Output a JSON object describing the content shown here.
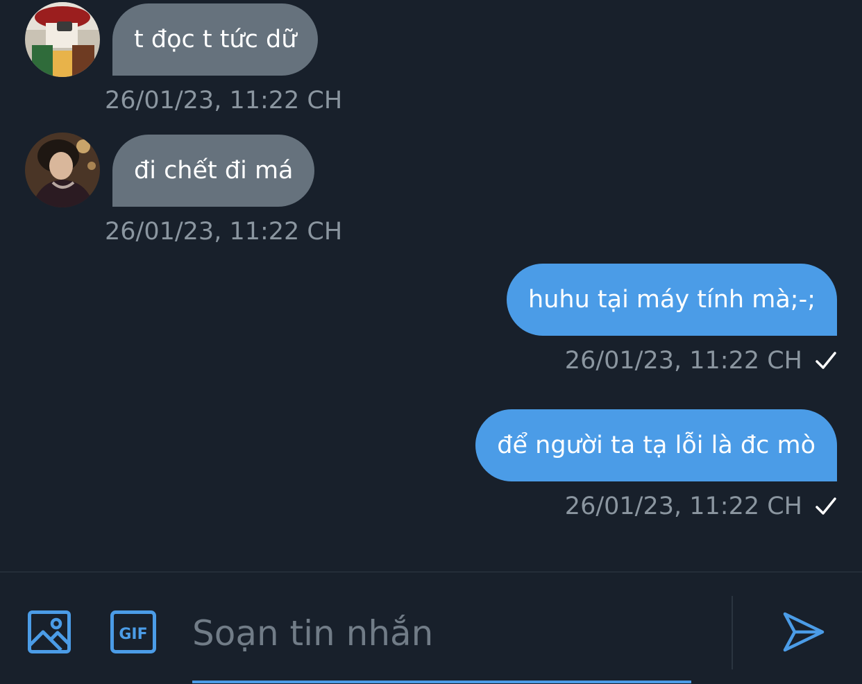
{
  "messages": [
    {
      "direction": "incoming",
      "text": "t đọc t tức dữ",
      "time": "26/01/23, 11:22 CH",
      "avatar": "avatar-photo-1"
    },
    {
      "direction": "incoming",
      "text": "đi chết đi má",
      "time": "26/01/23, 11:22 CH",
      "avatar": "avatar-photo-2"
    },
    {
      "direction": "outgoing",
      "text": "huhu tại máy tính mà;-;",
      "time": "26/01/23, 11:22 CH",
      "status_icon": "checkmark-icon"
    },
    {
      "direction": "outgoing",
      "text": "để người ta tạ lỗi là đc mò",
      "time": "26/01/23, 11:22 CH",
      "status_icon": "checkmark-icon"
    }
  ],
  "composer": {
    "placeholder": "Soạn tin nhắn",
    "value": "",
    "icons": [
      "image-icon",
      "gif-icon",
      "send-icon"
    ]
  },
  "colors": {
    "background": "#18202b",
    "incoming_bubble": "#66727d",
    "outgoing_bubble": "#4b9ce7",
    "timestamp": "#8b96a0",
    "accent": "#4b9ce7"
  }
}
